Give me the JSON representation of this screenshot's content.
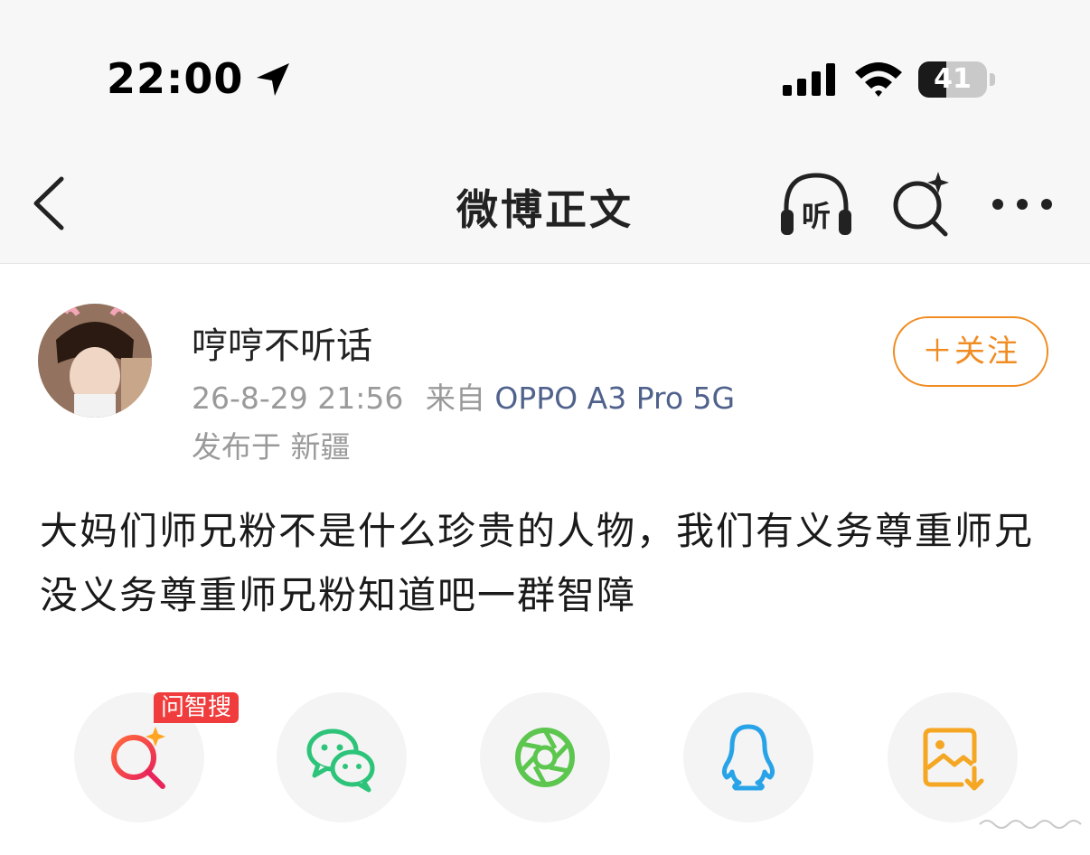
{
  "status_bar": {
    "time": "22:00",
    "battery_level": "41",
    "battery_percent": 41
  },
  "nav": {
    "title": "微博正文",
    "listen_label": "听"
  },
  "post": {
    "author": {
      "name": "哼哼不听话"
    },
    "timestamp": "26-8-29 21:56",
    "source_prefix": "来自",
    "source_device": "OPPO A3 Pro 5G",
    "location_label": "发布于 新疆",
    "follow_label": "＋关注",
    "content": "大妈们师兄粉不是什么珍贵的人物，我们有义务尊重师兄没义务尊重师兄粉知道吧一群智障"
  },
  "share_bar": {
    "badge": "问智搜",
    "items": [
      {
        "name": "ai-search-share",
        "icon": "ai-search-icon"
      },
      {
        "name": "wechat",
        "icon": "wechat-icon"
      },
      {
        "name": "moments",
        "icon": "moments-aperture-icon"
      },
      {
        "name": "qq",
        "icon": "qq-penguin-icon"
      },
      {
        "name": "save-image",
        "icon": "save-image-icon"
      }
    ]
  },
  "colors": {
    "follow_orange": "#f08c22",
    "device_link": "#50628c",
    "meta_gray": "#9a9a9a",
    "badge_red": "#f03c3c",
    "wechat_green": "#2dc47a",
    "moments_green": "#5cc64f",
    "qq_blue": "#28a3e8",
    "save_orange": "#f5a623"
  }
}
